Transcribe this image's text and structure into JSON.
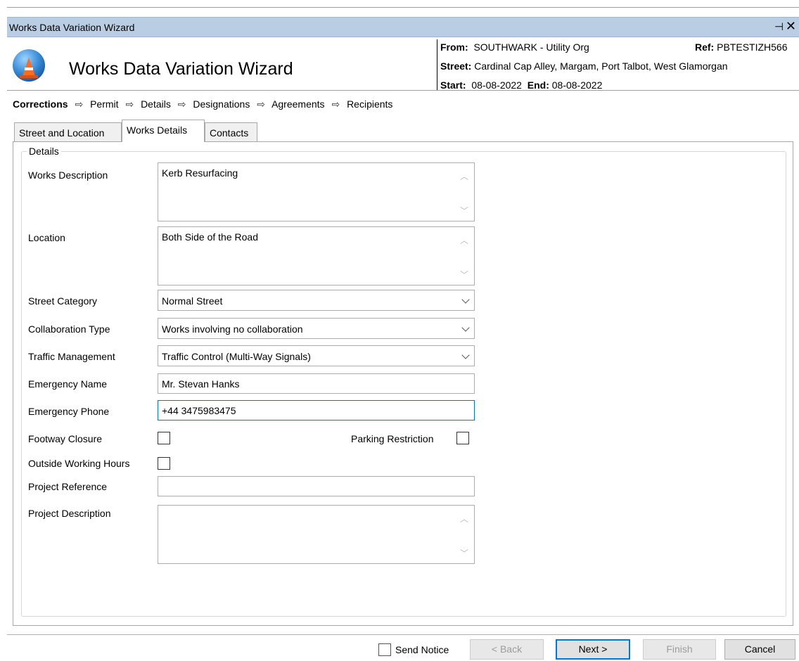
{
  "window": {
    "title": "Works Data Variation Wizard",
    "pin_icon": "pin-icon",
    "close_icon": "close-icon"
  },
  "header": {
    "wizard_title": "Works Data Variation Wizard",
    "from_label": "From:",
    "from_value": "SOUTHWARK - Utility Org",
    "ref_label": "Ref:",
    "ref_value": "PBTESTIZH566",
    "street_label": "Street:",
    "street_value": "Cardinal Cap Alley, Margam, Port Talbot, West Glamorgan",
    "start_label": "Start:",
    "start_value": "08-08-2022",
    "end_label": "End:",
    "end_value": "08-08-2022"
  },
  "steps": {
    "items": [
      {
        "label": "Corrections"
      },
      {
        "label": "Permit"
      },
      {
        "label": "Details"
      },
      {
        "label": "Designations"
      },
      {
        "label": "Agreements"
      },
      {
        "label": "Recipients"
      }
    ],
    "arrow": "⇨"
  },
  "tabs": [
    {
      "label": "Street and Location"
    },
    {
      "label": "Works Details"
    },
    {
      "label": "Contacts"
    }
  ],
  "details": {
    "group_label": "Details",
    "works_description": {
      "label": "Works Description",
      "value": "Kerb Resurfacing"
    },
    "location": {
      "label": "Location",
      "value": "Both Side of the Road"
    },
    "street_category": {
      "label": "Street Category",
      "value": "Normal Street"
    },
    "collaboration_type": {
      "label": "Collaboration Type",
      "value": "Works involving no collaboration"
    },
    "traffic_management": {
      "label": "Traffic Management",
      "value": "Traffic Control (Multi-Way Signals)"
    },
    "emergency_name": {
      "label": "Emergency Name",
      "value": "Mr. Stevan Hanks"
    },
    "emergency_phone": {
      "label": "Emergency Phone",
      "value": "+44 3475983475"
    },
    "footway_closure": {
      "label": "Footway Closure",
      "checked": false
    },
    "parking_restriction": {
      "label": "Parking Restriction",
      "checked": false
    },
    "outside_working_hours": {
      "label": "Outside Working Hours",
      "checked": false
    },
    "project_reference": {
      "label": "Project Reference",
      "value": ""
    },
    "project_description": {
      "label": "Project Description",
      "value": ""
    }
  },
  "footer": {
    "send_notice": "Send Notice",
    "back": "< Back",
    "next": "Next >",
    "finish": "Finish",
    "cancel": "Cancel"
  }
}
